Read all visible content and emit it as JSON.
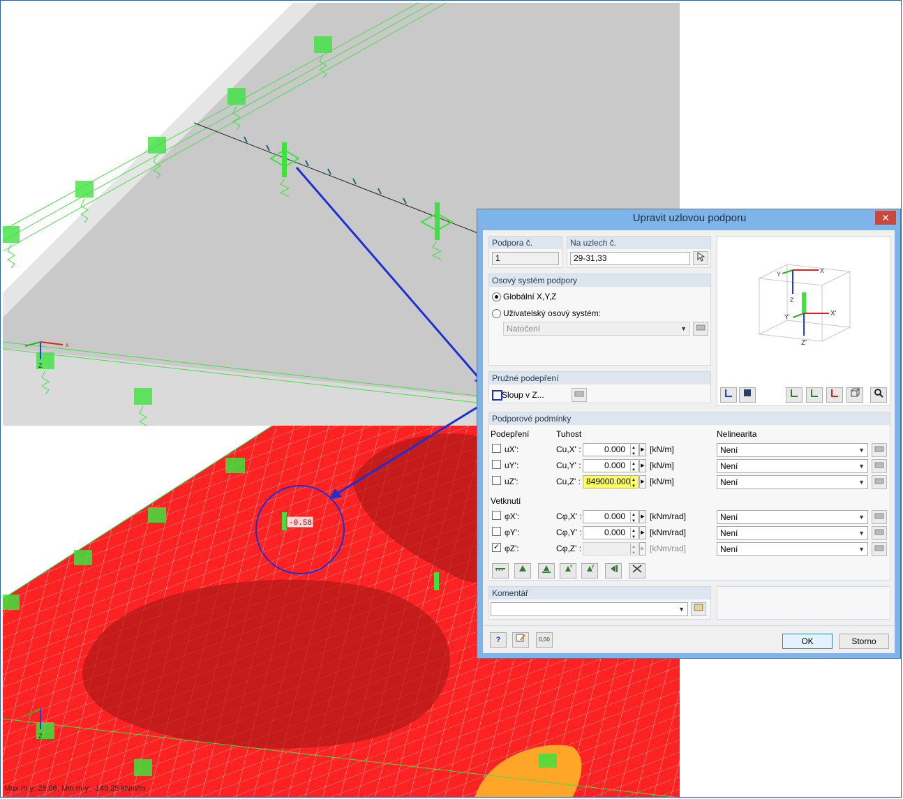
{
  "viewport_top": {
    "axis_labels": {
      "x": "x",
      "z": "Z"
    }
  },
  "viewport_bottom": {
    "value_label": "-0.58",
    "axis_labels": {
      "z": "Z"
    },
    "status": "Max m-y: 26.06, Min m-y: -149.25 kNm/m"
  },
  "dialog": {
    "title": "Upravit uzlovou podporu",
    "close_glyph": "✕",
    "support_no": {
      "label": "Podpora č.",
      "value": "1"
    },
    "nodes": {
      "label": "Na uzlech č.",
      "value": "29-31,33"
    },
    "axis_system": {
      "header": "Osový systém podpory",
      "global_label": "Globální X,Y,Z",
      "user_label": "Uživatelský osový systém:",
      "rotation_value": "Natočení"
    },
    "preview": {
      "labels": {
        "x": "X",
        "y": "Y",
        "z": "Z",
        "xp": "X'",
        "yp": "Y'",
        "zp": "Z'"
      }
    },
    "elastic": {
      "header": "Pružné podepření",
      "column_label": "Sloup v Z..."
    },
    "conditions": {
      "header": "Podporové podmínky",
      "col_support": "Podepření",
      "col_stiffness": "Tuhost",
      "col_nonlinear": "Nelinearita",
      "restraint_header": "Vetknutí",
      "rows": [
        {
          "label": "uX':",
          "coef": "Cu,X' :",
          "value": "0.000",
          "unit": "[kN/m]",
          "nonlin": "Není",
          "checked": false
        },
        {
          "label": "uY':",
          "coef": "Cu,Y' :",
          "value": "0.000",
          "unit": "[kN/m]",
          "nonlin": "Není",
          "checked": false
        },
        {
          "label": "uZ':",
          "coef": "Cu,Z' :",
          "value": "849000.000",
          "unit": "[kN/m]",
          "nonlin": "Není",
          "checked": false
        },
        {
          "label": "φX':",
          "coef": "Cφ,X' :",
          "value": "0.000",
          "unit": "[kNm/rad]",
          "nonlin": "Není",
          "checked": false
        },
        {
          "label": "φY':",
          "coef": "Cφ,Y' :",
          "value": "0.000",
          "unit": "[kNm/rad]",
          "nonlin": "Není",
          "checked": false
        },
        {
          "label": "φZ':",
          "coef": "Cφ,Z' :",
          "value": "",
          "unit": "[kNm/rad]",
          "nonlin": "Není",
          "checked": true
        }
      ],
      "check_glyph": "✓"
    },
    "comment": {
      "label": "Komentář",
      "value": ""
    },
    "ok_label": "OK",
    "cancel_label": "Storno",
    "help_glyph": "?",
    "units_glyph": "0,00",
    "colors": {
      "title_bar": "#7eb4ea",
      "highlight_field": "#ffff66",
      "result_red": "#ff2b2b"
    }
  }
}
